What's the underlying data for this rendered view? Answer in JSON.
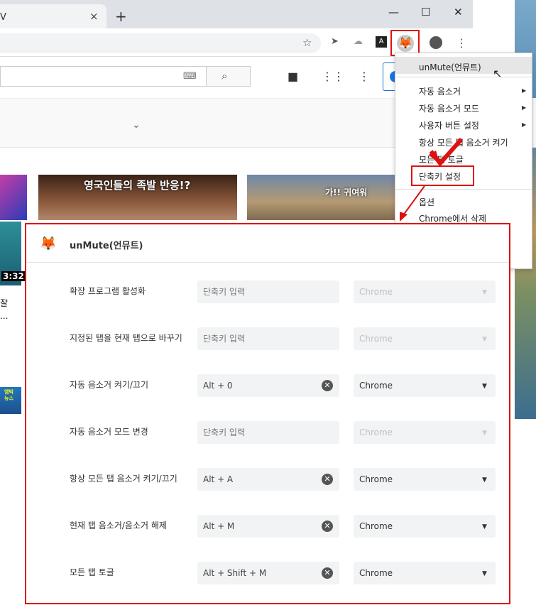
{
  "browser": {
    "tab_title": "V",
    "tab_close": "×",
    "new_tab": "+",
    "window_controls": [
      "—",
      "☐",
      "✕"
    ],
    "toolbar_icons": [
      "star-icon",
      "cursor-extension-icon",
      "cloud-extension-icon",
      "a-extension-icon",
      "unmute-fox-icon",
      "account-icon",
      "more-vert-icon"
    ]
  },
  "youtube": {
    "thumb2_text": "영국인들의 족발 반응!?",
    "thumb3_text": "가!! 귀여워",
    "duration": "3:32",
    "left_text_1": "잘",
    "left_text_2": "...",
    "thumb5_text": "엠빅\n뉴스"
  },
  "extension_menu": {
    "header": "unMute(언뮤트)",
    "items": [
      {
        "label": "자동 음소거",
        "submenu": true
      },
      {
        "label": "자동 음소거 모드",
        "submenu": true
      },
      {
        "label": "사용자 버튼 설정",
        "submenu": true
      },
      {
        "label": "항상 모든 탭 음소거 켜기",
        "submenu": false
      },
      {
        "label": "모든 탭 토글",
        "submenu": false
      },
      {
        "label": "단축키 설정",
        "submenu": false
      }
    ],
    "options": "옵션",
    "remove": "Chrome에서 삭제"
  },
  "shortcuts_panel": {
    "title": "unMute(언뮤트)",
    "rows": [
      {
        "label": "확장 프로그램 활성화",
        "value": "단축키 입력",
        "has_value": false,
        "scope": "Chrome",
        "scope_enabled": false
      },
      {
        "label": "지정된 탭을 현재 탭으로 바꾸기",
        "value": "단축키 입력",
        "has_value": false,
        "scope": "Chrome",
        "scope_enabled": false
      },
      {
        "label": "자동 음소거 켜기/끄기",
        "value": "Alt + 0",
        "has_value": true,
        "scope": "Chrome",
        "scope_enabled": true
      },
      {
        "label": "자동 음소거 모드 변경",
        "value": "단축키 입력",
        "has_value": false,
        "scope": "Chrome",
        "scope_enabled": false
      },
      {
        "label": "항상 모든 탭 음소거 켜기/끄기",
        "value": "Alt + A",
        "has_value": true,
        "scope": "Chrome",
        "scope_enabled": true
      },
      {
        "label": "현재 탭 음소거/음소거 해제",
        "value": "Alt + M",
        "has_value": true,
        "scope": "Chrome",
        "scope_enabled": true
      },
      {
        "label": "모든 탭 토글",
        "value": "Alt + Shift + M",
        "has_value": true,
        "scope": "Chrome",
        "scope_enabled": true
      }
    ]
  },
  "colors": {
    "annotation_red": "#dd1111",
    "field_bg": "#f1f3f4"
  }
}
